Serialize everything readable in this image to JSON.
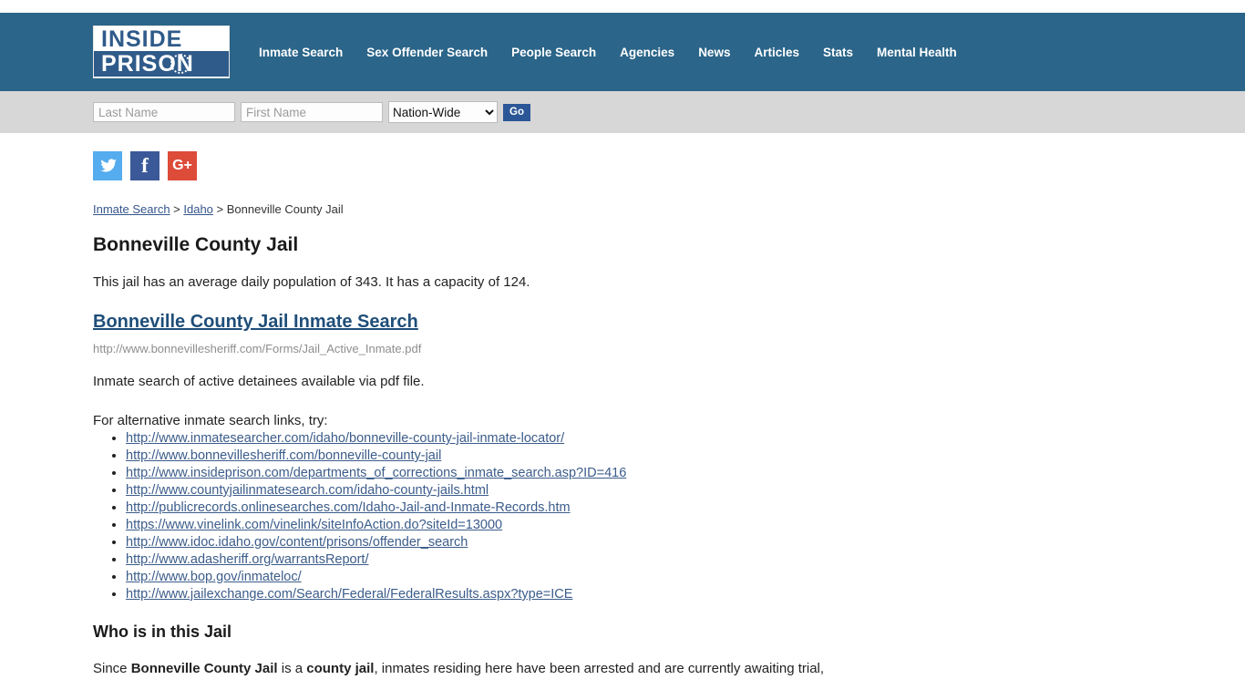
{
  "brand": {
    "logo_line1": "INSIDE",
    "logo_line2": "PRISON"
  },
  "nav": {
    "items": [
      {
        "label": "Inmate Search"
      },
      {
        "label": "Sex Offender Search"
      },
      {
        "label": "People Search"
      },
      {
        "label": "Agencies"
      },
      {
        "label": "News"
      },
      {
        "label": "Articles"
      },
      {
        "label": "Stats"
      },
      {
        "label": "Mental Health"
      }
    ]
  },
  "search": {
    "last_name_placeholder": "Last Name",
    "last_name_value": "",
    "first_name_placeholder": "First Name",
    "first_name_value": "",
    "scope_selected": "Nation-Wide",
    "scope_options": [
      "Nation-Wide"
    ],
    "go_label": "Go"
  },
  "social": {
    "twitter": {
      "name": "twitter-icon",
      "glyph": "ᵗ",
      "color": "#55acee"
    },
    "facebook": {
      "name": "facebook-icon",
      "glyph": "f",
      "color": "#3b5998"
    },
    "googleplus": {
      "name": "google-plus-icon",
      "glyph": "G+",
      "color": "#dd4b39"
    }
  },
  "breadcrumb": {
    "item1": "Inmate Search",
    "sep1": " > ",
    "item2": "Idaho",
    "sep2": " > ",
    "current": "Bonneville County Jail"
  },
  "page": {
    "title": "Bonneville County Jail",
    "lead": "This jail has an average daily population of 343. It has a capacity of 124.",
    "average_daily_population": 343,
    "capacity": 124,
    "search_link_label": "Bonneville County Jail Inmate Search",
    "search_link_url": "http://www.bonnevillesheriff.com/Forms/Jail_Active_Inmate.pdf",
    "search_description": "Inmate search of active detainees available via pdf file.",
    "alt_intro": "For alternative inmate search links, try:",
    "alt_links": [
      "http://www.inmatesearcher.com/idaho/bonneville-county-jail-inmate-locator/",
      "http://www.bonnevillesheriff.com/bonneville-county-jail",
      "http://www.insideprison.com/departments_of_corrections_inmate_search.asp?ID=416",
      "http://www.countyjailinmatesearch.com/idaho-county-jails.html",
      "http://publicrecords.onlinesearches.com/Idaho-Jail-and-Inmate-Records.htm",
      "https://www.vinelink.com/vinelink/siteInfoAction.do?siteId=13000",
      "http://www.idoc.idaho.gov/content/prisons/offender_search",
      "http://www.adasheriff.org/warrantsReport/",
      "http://www.bop.gov/inmateloc/",
      "http://www.jailexchange.com/Search/Federal/FederalResults.aspx?type=ICE"
    ],
    "who_heading": "Who is in this Jail",
    "who_text_1": "Since ",
    "who_bold_1": "Bonneville County Jail",
    "who_text_2": " is a ",
    "who_bold_2": "county jail",
    "who_text_3": ", inmates residing here have been arrested and are currently awaiting trial,"
  },
  "colors": {
    "header_blue": "#2b6589",
    "logo_blue": "#2f5b8a",
    "searchbar_gray": "#d7d7d7",
    "go_button": "#2b5797",
    "heading_link": "#1f4e79",
    "list_link": "#3b5c8a",
    "breadcrumb_link": "#34558b"
  }
}
